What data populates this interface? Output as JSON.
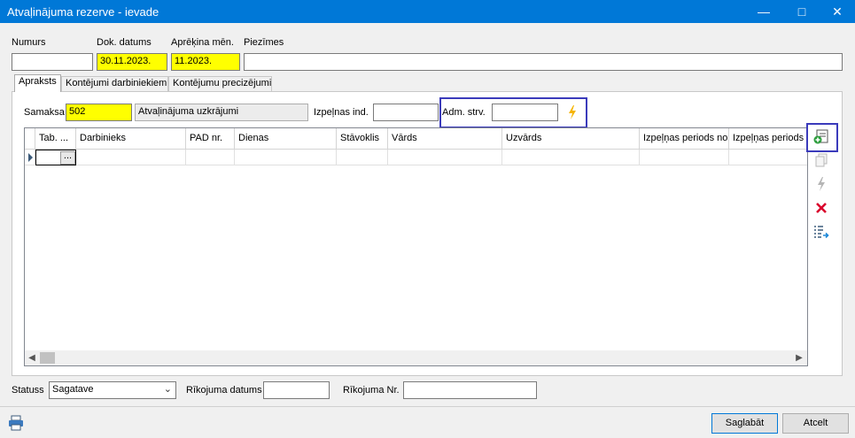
{
  "window": {
    "title": "Atvaļinājuma rezerve - ievade",
    "minimize_icon": "minimize-icon",
    "maximize_icon": "maximize-icon",
    "close_icon": "close-icon"
  },
  "header": {
    "numurs_label": "Numurs",
    "numurs_value": "",
    "dok_datums_label": "Dok. datums",
    "dok_datums_value": "30.11.2023.",
    "aprekina_men_label": "Aprēķina mēn.",
    "aprekina_men_value": "11.2023.",
    "piezimes_label": "Piezīmes",
    "piezimes_value": ""
  },
  "tabs": [
    {
      "label": "Apraksts",
      "active": true
    },
    {
      "label": "Kontējumi darbiniekiem",
      "active": false
    },
    {
      "label": "Kontējumu precizējumi",
      "active": false
    }
  ],
  "filters": {
    "samaksa_label": "Samaksa",
    "samaksa_code": "502",
    "samaksa_name": "Atvaļinājuma uzkrājumi",
    "izpelnas_ind_label": "Izpeļnas ind.",
    "izpelnas_ind_value": "",
    "adm_strv_label": "Adm. strv.",
    "adm_strv_value": "",
    "lightning_icon": "lightning-icon"
  },
  "grid": {
    "columns": [
      "Tab. ...",
      "Darbinieks",
      "PAD nr.",
      "Dienas",
      "Stāvoklis",
      "Vārds",
      "Uzvārds",
      "Izpeļņas periods no",
      "Izpeļņas periods ..."
    ],
    "row_button": "..."
  },
  "side_toolbar": {
    "icons": [
      "add-row-icon",
      "copy-icon",
      "lightning-disabled-icon",
      "delete-icon",
      "list-arrow-icon"
    ]
  },
  "footer": {
    "statuss_label": "Statuss",
    "statuss_value": "Sagatave",
    "rikojuma_datums_label": "Rīkojuma datums",
    "rikojuma_datums_value": "",
    "rikojuma_nr_label": "Rīkojuma Nr.",
    "rikojuma_nr_value": "",
    "save_label": "Saglabāt",
    "cancel_label": "Atcelt",
    "print_icon": "print-icon"
  },
  "colors": {
    "titlebar": "#0078d7",
    "highlight": "#ffff00",
    "focus_border": "#3b3bbb",
    "delete": "#d9002b",
    "lightning": "#f5b400"
  }
}
